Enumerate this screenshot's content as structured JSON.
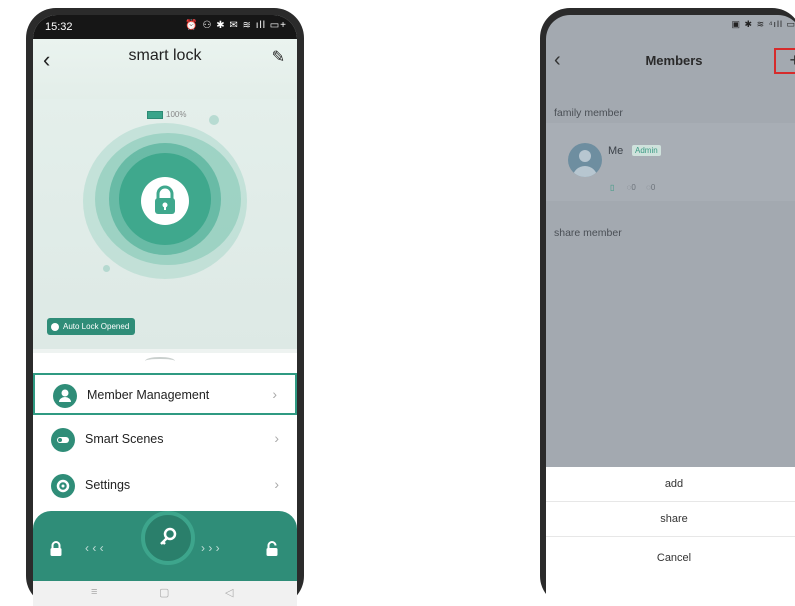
{
  "left_screen": {
    "status_bar": {
      "time": "15:32",
      "icons": "⏰ ⚇ ✱ ✉ ≋ ıll ▭+"
    },
    "title": "smart lock",
    "battery": "100%",
    "auto_lock_badge": "Auto Lock Opened",
    "menu": [
      {
        "label": "Member Management",
        "icon": "person-icon"
      },
      {
        "label": "Smart Scenes",
        "icon": "toggle-icon"
      },
      {
        "label": "Settings",
        "icon": "gear-icon"
      }
    ],
    "bottom": {
      "left_arrows": "‹ ‹ ‹",
      "right_arrows": "› › ›"
    },
    "colors": {
      "accent": "#2f8d78",
      "highlight_border": "#2f9a82"
    }
  },
  "right_screen": {
    "status_icons": "▣ ✱ ≋ ⁴ıll ▭",
    "title": "Members",
    "family_section": "family member",
    "member": {
      "name": "Me",
      "role": "Admin",
      "fp_count": "0",
      "card_count": "0"
    },
    "share_section": "share member",
    "sheet_options": [
      "add",
      "share",
      "Cancel"
    ],
    "colors": {
      "highlight_box": "#d62b2b",
      "overlay": "#a3a9b0"
    }
  }
}
